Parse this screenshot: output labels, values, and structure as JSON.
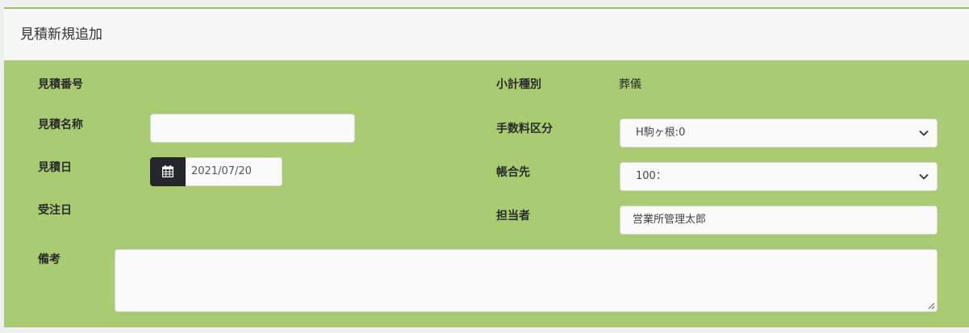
{
  "form": {
    "title": "見積新規追加",
    "left": {
      "estimate_number_label": "見積番号",
      "estimate_name_label": "見積名称",
      "estimate_name_value": "",
      "estimate_date_label": "見積日",
      "estimate_date_value": "2021/07/20",
      "order_date_label": "受注日",
      "remarks_label": "備考",
      "remarks_value": ""
    },
    "right": {
      "subtotal_type_label": "小計種別",
      "subtotal_type_value": "葬儀",
      "fee_category_label": "手数料区分",
      "fee_category_selected": "H駒ヶ根:0",
      "ledger_label": "帳合先",
      "ledger_selected": "100：",
      "staff_label": "担当者",
      "staff_value": "営業所管理太郎"
    }
  },
  "icons": {
    "calendar": "calendar-icon",
    "dropdown": "chevron-down-icon",
    "resize": "resize-grip-icon"
  },
  "colors": {
    "panel_background": "#a9cc72",
    "header_background": "#f7f7f7",
    "calendar_addon": "#24262b"
  }
}
